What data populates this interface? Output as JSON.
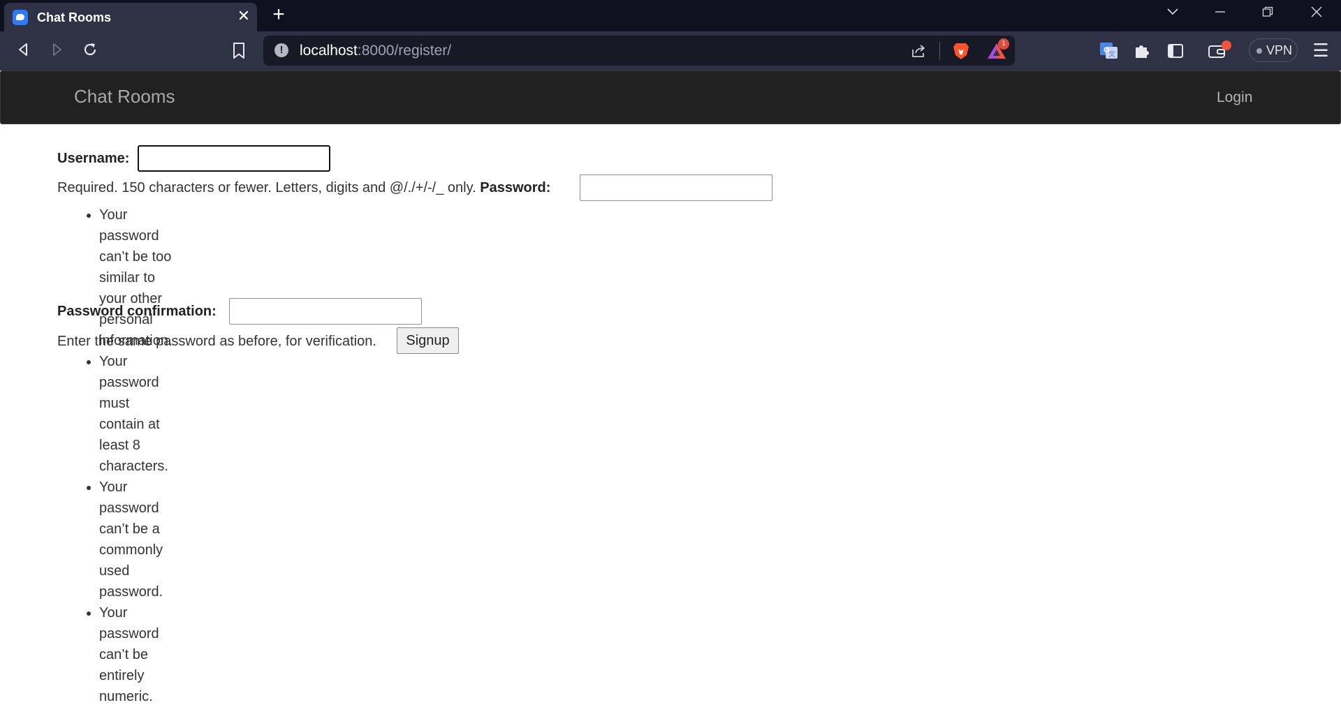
{
  "browser": {
    "tab": {
      "title": "Chat Rooms"
    },
    "address": {
      "host": "localhost",
      "path": ":8000/register/"
    },
    "rewards_badge": "1",
    "vpn_label": "VPN"
  },
  "site": {
    "brand": "Chat Rooms",
    "login_link": "Login"
  },
  "form": {
    "username_label": "Username:",
    "username_help": "Required. 150 characters or fewer. Letters, digits and @/./+/-/_ only.",
    "password_label": "Password:",
    "password_rules": [
      "Your password can’t be too similar to your other personal information.",
      "Your password must contain at least 8 characters.",
      "Your password can’t be a commonly used password.",
      "Your password can’t be entirely numeric."
    ],
    "confirm_label": "Password confirmation:",
    "confirm_help": "Enter the same password as before, for verification.",
    "submit_label": "Signup"
  }
}
